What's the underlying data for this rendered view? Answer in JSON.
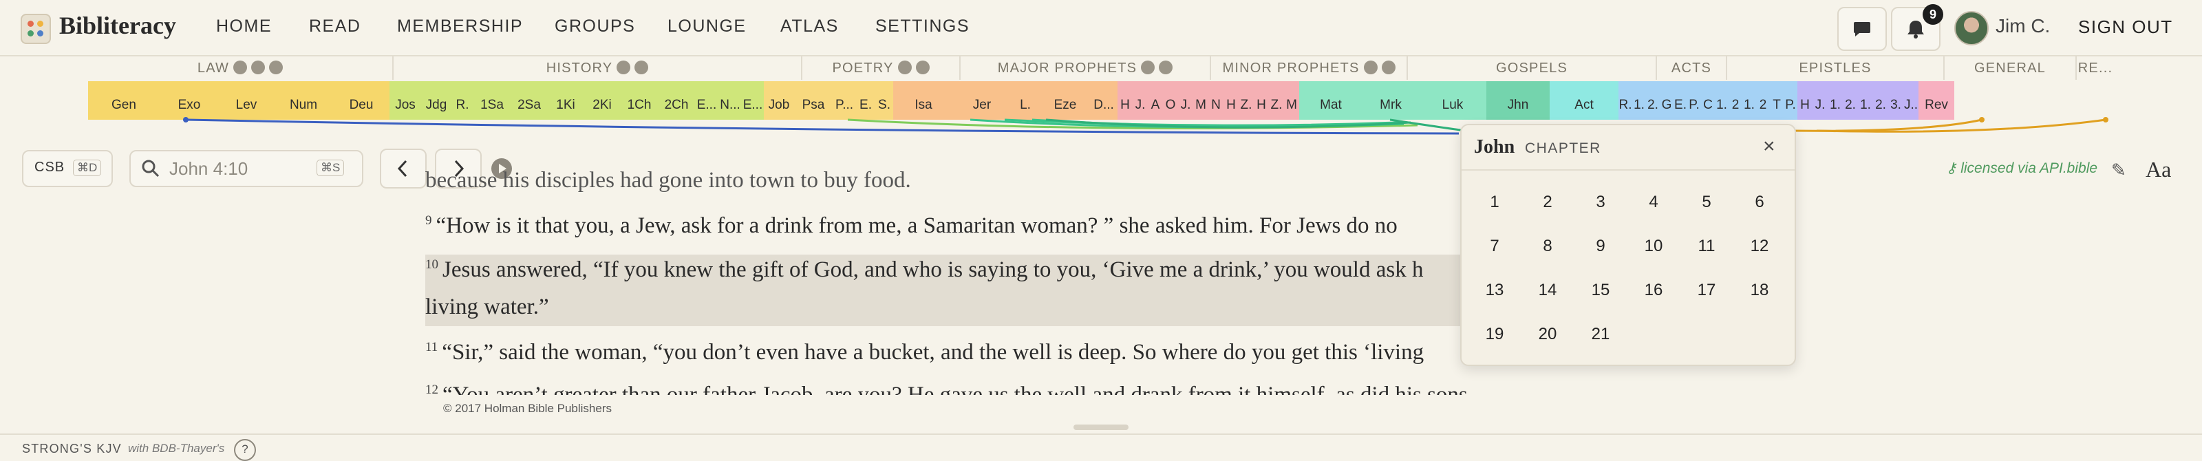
{
  "app": {
    "brand": "Bibliteracy",
    "user_name": "Jim C.",
    "sign_out": "SIGN OUT",
    "notification_count": "9"
  },
  "nav": [
    "HOME",
    "READ",
    "MEMBERSHIP",
    "GROUPS",
    "LOUNGE",
    "ATLAS",
    "SETTINGS"
  ],
  "sections": [
    "LAW",
    "HISTORY",
    "POETRY",
    "MAJOR PROPHETS",
    "MINOR PROPHETS",
    "GOSPELS",
    "ACTS",
    "EPISTLES",
    "GENERAL",
    "RE..."
  ],
  "books": [
    {
      "label": "Gen",
      "color": "#f6d76b"
    },
    {
      "label": "Exo",
      "color": "#f6d76b"
    },
    {
      "label": "Lev",
      "color": "#f6d76b"
    },
    {
      "label": "Num",
      "color": "#f6d76b"
    },
    {
      "label": "Deu",
      "color": "#f6d76b"
    },
    {
      "label": "Jos",
      "color": "#cfe67a"
    },
    {
      "label": "Jdg",
      "color": "#cfe67a"
    },
    {
      "label": "R.",
      "color": "#cfe67a"
    },
    {
      "label": "1Sa",
      "color": "#cfe67a"
    },
    {
      "label": "2Sa",
      "color": "#cfe67a"
    },
    {
      "label": "1Ki",
      "color": "#cfe67a"
    },
    {
      "label": "2Ki",
      "color": "#cfe67a"
    },
    {
      "label": "1Ch",
      "color": "#cfe67a"
    },
    {
      "label": "2Ch",
      "color": "#cfe67a"
    },
    {
      "label": "E...",
      "color": "#cfe67a"
    },
    {
      "label": "N...",
      "color": "#cfe67a"
    },
    {
      "label": "E...",
      "color": "#cfe67a"
    },
    {
      "label": "Job",
      "color": "#f8d97e"
    },
    {
      "label": "Psa",
      "color": "#f8d97e"
    },
    {
      "label": "P...",
      "color": "#f8d97e"
    },
    {
      "label": "E.",
      "color": "#f8d97e"
    },
    {
      "label": "S.",
      "color": "#f8d97e"
    },
    {
      "label": "Isa",
      "color": "#f9c18b"
    },
    {
      "label": "Jer",
      "color": "#f9c18b"
    },
    {
      "label": "L.",
      "color": "#f9c18b"
    },
    {
      "label": "Eze",
      "color": "#f9c18b"
    },
    {
      "label": "D...",
      "color": "#f9c18b"
    },
    {
      "label": "H",
      "color": "#f5b0b4"
    },
    {
      "label": "J.",
      "color": "#f5b0b4"
    },
    {
      "label": "A",
      "color": "#f5b0b4"
    },
    {
      "label": "O",
      "color": "#f5b0b4"
    },
    {
      "label": "J.",
      "color": "#f5b0b4"
    },
    {
      "label": "M",
      "color": "#f5b0b4"
    },
    {
      "label": "N",
      "color": "#f5b0b4"
    },
    {
      "label": "H",
      "color": "#f5b0b4"
    },
    {
      "label": "Z.",
      "color": "#f5b0b4"
    },
    {
      "label": "H",
      "color": "#f5b0b4"
    },
    {
      "label": "Z.",
      "color": "#f5b0b4"
    },
    {
      "label": "M",
      "color": "#f5b0b4"
    },
    {
      "label": "Mat",
      "color": "#8ee6c4"
    },
    {
      "label": "Mrk",
      "color": "#8ee6c4"
    },
    {
      "label": "Luk",
      "color": "#8ee6c4"
    },
    {
      "label": "Jhn",
      "color": "#74d4ad"
    },
    {
      "label": "Act",
      "color": "#8fe9e2"
    },
    {
      "label": "R.",
      "color": "#a5d2f5"
    },
    {
      "label": "1.",
      "color": "#a5d2f5"
    },
    {
      "label": "2.",
      "color": "#a5d2f5"
    },
    {
      "label": "G",
      "color": "#a5d2f5"
    },
    {
      "label": "E.",
      "color": "#a5d2f5"
    },
    {
      "label": "P.",
      "color": "#a5d2f5"
    },
    {
      "label": "C",
      "color": "#a5d2f5"
    },
    {
      "label": "1.",
      "color": "#a5d2f5"
    },
    {
      "label": "2",
      "color": "#a5d2f5"
    },
    {
      "label": "1.",
      "color": "#a5d2f5"
    },
    {
      "label": "2",
      "color": "#a5d2f5"
    },
    {
      "label": "T",
      "color": "#a5d2f5"
    },
    {
      "label": "P.",
      "color": "#a5d2f5"
    },
    {
      "label": "H",
      "color": "#bfb3f6"
    },
    {
      "label": "J.",
      "color": "#bfb3f6"
    },
    {
      "label": "1.",
      "color": "#bfb3f6"
    },
    {
      "label": "2.",
      "color": "#bfb3f6"
    },
    {
      "label": "1.",
      "color": "#bfb3f6"
    },
    {
      "label": "2.",
      "color": "#bfb3f6"
    },
    {
      "label": "3.",
      "color": "#bfb3f6"
    },
    {
      "label": "J..",
      "color": "#bfb3f6"
    },
    {
      "label": "Rev",
      "color": "#f7b0c0"
    }
  ],
  "toolbar": {
    "version": "CSB",
    "version_shortcut": "⌘D",
    "search_placeholder": "John 4:10",
    "search_shortcut": "⌘S"
  },
  "reader": {
    "partial_top": "because his disciples had gone into town to buy food.",
    "verses": [
      {
        "num": "9",
        "text": "“How is it that you, a Jew, ask for a drink from me, a Samaritan woman? ” she asked him. For Jews do no"
      },
      {
        "num": "10",
        "text": "Jesus answered, “If you knew the gift of God, and who is saying to you, ‘Give me a drink,’ you would ask h"
      },
      {
        "num": "",
        "text": "living water.”"
      },
      {
        "num": "11",
        "text": "“Sir,” said the woman, “you don’t even have a bucket, and the well is deep. So where do you get this ‘living"
      },
      {
        "num": "12",
        "text": "“You aren’t greater than our father Jacob, are you? He gave us the well and drank from it himself, as did his sons and livestock.”"
      }
    ],
    "copyright": "© 2017 Holman Bible Publishers",
    "license": "licensed via API.bible",
    "font_button": "Aa"
  },
  "chapter_popup": {
    "book": "John",
    "label": "CHAPTER",
    "chapters": [
      "1",
      "2",
      "3",
      "4",
      "5",
      "6",
      "7",
      "8",
      "9",
      "10",
      "11",
      "12",
      "13",
      "14",
      "15",
      "16",
      "17",
      "18",
      "19",
      "20",
      "21"
    ]
  },
  "footer": {
    "title": "STRONG'S KJV",
    "subtitle": "with BDB-Thayer's",
    "help": "?"
  }
}
